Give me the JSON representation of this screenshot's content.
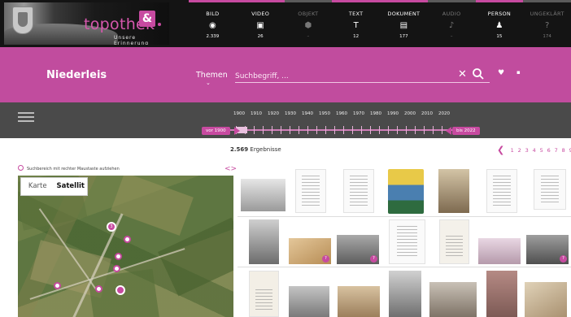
{
  "brand": {
    "name": "topothek",
    "tagline": "Unsere Erinnerung",
    "mark": "&"
  },
  "categories": [
    {
      "label": "BILD",
      "count": "2.339",
      "icon": "camera-icon",
      "glyph": "◉",
      "active": true
    },
    {
      "label": "VIDEO",
      "count": "26",
      "icon": "film-icon",
      "glyph": "▣",
      "active": true
    },
    {
      "label": "OBJEKT",
      "count": "–",
      "icon": "object-icon",
      "glyph": "⬢",
      "active": false
    },
    {
      "label": "TEXT",
      "count": "12",
      "icon": "text-icon",
      "glyph": "T",
      "active": true
    },
    {
      "label": "DOKUMENT",
      "count": "177",
      "icon": "document-icon",
      "glyph": "▤",
      "active": true
    },
    {
      "label": "AUDIO",
      "count": "–",
      "icon": "audio-icon",
      "glyph": "♪",
      "active": false
    },
    {
      "label": "PERSON",
      "count": "15",
      "icon": "person-icon",
      "glyph": "♟",
      "active": true
    },
    {
      "label": "UNGEKLÄRT",
      "count": "174",
      "icon": "question-icon",
      "glyph": "?",
      "active": false
    }
  ],
  "search": {
    "place": "Niederleis",
    "themen_label": "Themen",
    "placeholder": "Suchbegriff, ..."
  },
  "timeline": {
    "years": [
      "1900",
      "1910",
      "1920",
      "1930",
      "1940",
      "1950",
      "1960",
      "1970",
      "1980",
      "1990",
      "2000",
      "2010",
      "2020"
    ],
    "from_label": "vor 1900",
    "to_label": "bis 2022"
  },
  "results": {
    "count": "2.569",
    "label": "Ergebnisse"
  },
  "pagination": {
    "pages": [
      "1",
      "2",
      "3",
      "4",
      "5",
      "6",
      "7",
      "8",
      "9"
    ]
  },
  "map": {
    "hint": "Suchbereich mit rechter Maustaste aufziehen",
    "mode_map": "Karte",
    "mode_satellite": "Satellit",
    "active_mode": "Satellit",
    "cluster_label": "3"
  },
  "colors": {
    "brand": "#c14c9e",
    "header_bg": "#141414",
    "timeline_bg": "#4a4a4a"
  }
}
